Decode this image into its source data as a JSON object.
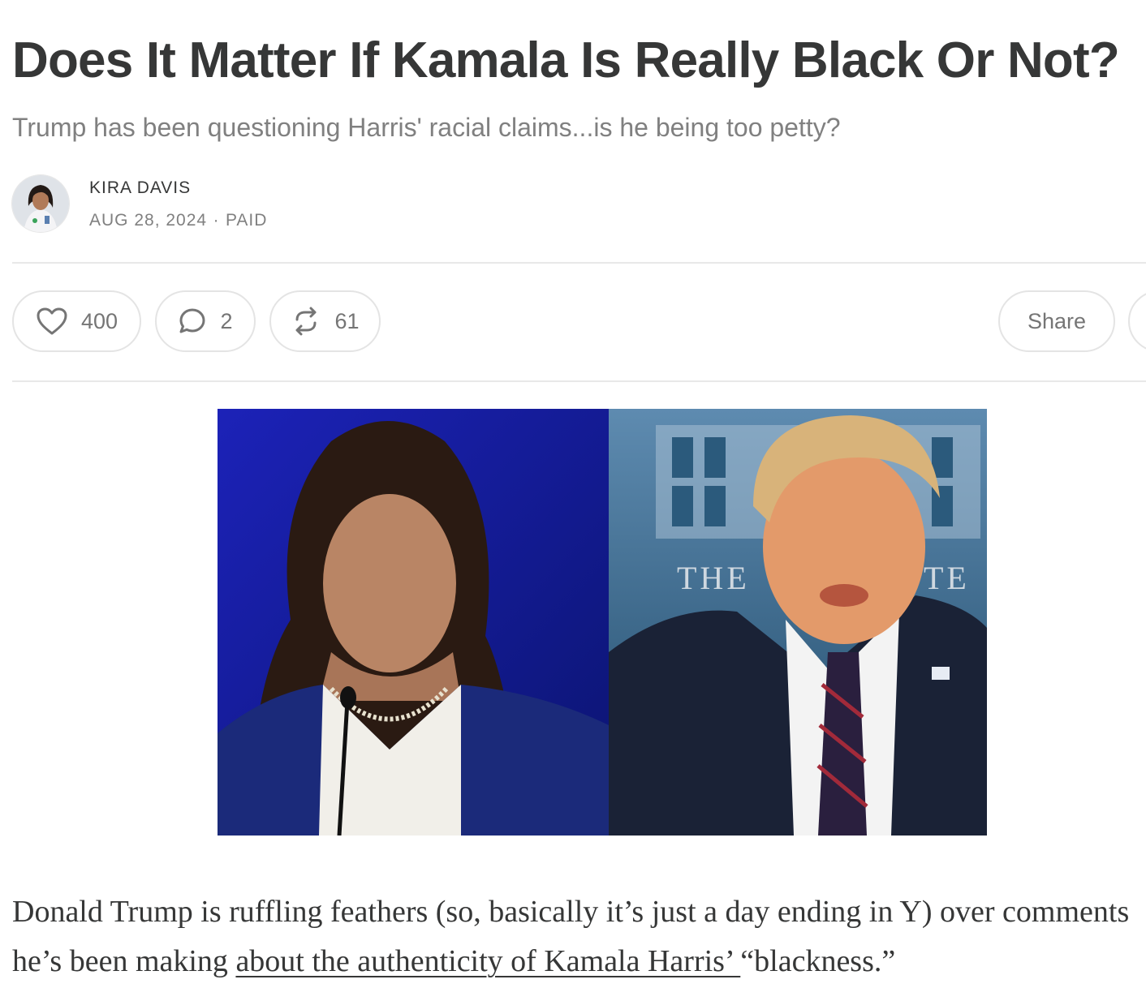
{
  "post": {
    "title": "Does It Matter If Kamala Is Really Black Or Not?",
    "subtitle": "Trump has been questioning Harris' racial claims...is he being too petty?",
    "author": "KIRA DAVIS",
    "date": "AUG 28, 2024",
    "separator": "∙",
    "access": "PAID"
  },
  "actions": {
    "likes": "400",
    "comments": "2",
    "restacks": "61",
    "share_label": "Share"
  },
  "hero_image": {
    "sign_text_left": "THE",
    "sign_text_right": "TE"
  },
  "body": {
    "p1_before": "Donald Trump is ruffling feathers (so, basically it’s just a day ending in Y) over comments he’s been making ",
    "p1_link": "about the authenticity of Kamala Harris’ ",
    "p1_after": "“blackness.”"
  },
  "colors": {
    "text": "#363737",
    "muted": "#808080",
    "border": "#e4e4e4"
  },
  "icons": [
    "heart-icon",
    "comment-icon",
    "restack-icon"
  ]
}
